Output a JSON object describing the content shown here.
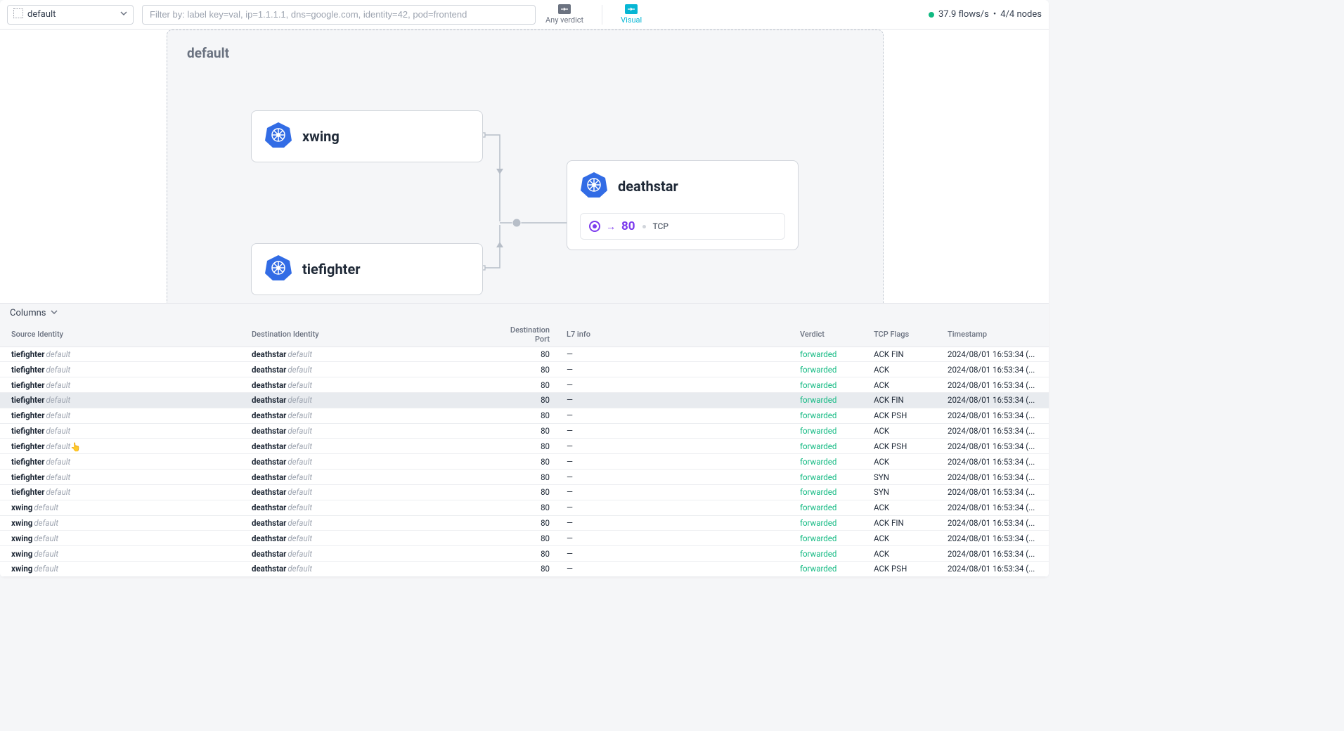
{
  "header": {
    "namespace": "default",
    "filter_placeholder": "Filter by: label key=val, ip=1.1.1.1, dns=google.com, identity=42, pod=frontend",
    "tabs": {
      "any_verdict": "Any verdict",
      "visual": "Visual"
    },
    "status": {
      "flows_rate": "37.9 flows/s",
      "separator": "•",
      "nodes": "4/4 nodes"
    }
  },
  "canvas": {
    "namespace_label": "default",
    "nodes": {
      "xwing": "xwing",
      "tiefighter": "tiefighter",
      "deathstar": {
        "name": "deathstar",
        "port": "80",
        "protocol": "TCP"
      }
    }
  },
  "table": {
    "columns_toggle": "Columns",
    "headers": {
      "source": "Source Identity",
      "destination": "Destination Identity",
      "dest_port": "Destination Port",
      "l7": "L7 info",
      "verdict": "Verdict",
      "tcp_flags": "TCP Flags",
      "timestamp": "Timestamp"
    },
    "rows": [
      {
        "src": "tiefighter",
        "src_ns": "default",
        "dst": "deathstar",
        "dst_ns": "default",
        "port": "80",
        "l7": "—",
        "verdict": "forwarded",
        "flags": "ACK FIN",
        "ts": "2024/08/01 16:53:34 (...",
        "hl": false
      },
      {
        "src": "tiefighter",
        "src_ns": "default",
        "dst": "deathstar",
        "dst_ns": "default",
        "port": "80",
        "l7": "—",
        "verdict": "forwarded",
        "flags": "ACK",
        "ts": "2024/08/01 16:53:34 (...",
        "hl": false
      },
      {
        "src": "tiefighter",
        "src_ns": "default",
        "dst": "deathstar",
        "dst_ns": "default",
        "port": "80",
        "l7": "—",
        "verdict": "forwarded",
        "flags": "ACK",
        "ts": "2024/08/01 16:53:34 (...",
        "hl": false
      },
      {
        "src": "tiefighter",
        "src_ns": "default",
        "dst": "deathstar",
        "dst_ns": "default",
        "port": "80",
        "l7": "—",
        "verdict": "forwarded",
        "flags": "ACK FIN",
        "ts": "2024/08/01 16:53:34 (...",
        "hl": true
      },
      {
        "src": "tiefighter",
        "src_ns": "default",
        "dst": "deathstar",
        "dst_ns": "default",
        "port": "80",
        "l7": "—",
        "verdict": "forwarded",
        "flags": "ACK PSH",
        "ts": "2024/08/01 16:53:34 (...",
        "hl": false
      },
      {
        "src": "tiefighter",
        "src_ns": "default",
        "dst": "deathstar",
        "dst_ns": "default",
        "port": "80",
        "l7": "—",
        "verdict": "forwarded",
        "flags": "ACK",
        "ts": "2024/08/01 16:53:34 (...",
        "hl": false
      },
      {
        "src": "tiefighter",
        "src_ns": "default",
        "dst": "deathstar",
        "dst_ns": "default",
        "port": "80",
        "l7": "—",
        "verdict": "forwarded",
        "flags": "ACK PSH",
        "ts": "2024/08/01 16:53:34 (...",
        "hl": false
      },
      {
        "src": "tiefighter",
        "src_ns": "default",
        "dst": "deathstar",
        "dst_ns": "default",
        "port": "80",
        "l7": "—",
        "verdict": "forwarded",
        "flags": "ACK",
        "ts": "2024/08/01 16:53:34 (...",
        "hl": false
      },
      {
        "src": "tiefighter",
        "src_ns": "default",
        "dst": "deathstar",
        "dst_ns": "default",
        "port": "80",
        "l7": "—",
        "verdict": "forwarded",
        "flags": "SYN",
        "ts": "2024/08/01 16:53:34 (...",
        "hl": false
      },
      {
        "src": "tiefighter",
        "src_ns": "default",
        "dst": "deathstar",
        "dst_ns": "default",
        "port": "80",
        "l7": "—",
        "verdict": "forwarded",
        "flags": "SYN",
        "ts": "2024/08/01 16:53:34 (...",
        "hl": false
      },
      {
        "src": "xwing",
        "src_ns": "default",
        "dst": "deathstar",
        "dst_ns": "default",
        "port": "80",
        "l7": "—",
        "verdict": "forwarded",
        "flags": "ACK",
        "ts": "2024/08/01 16:53:34 (...",
        "hl": false
      },
      {
        "src": "xwing",
        "src_ns": "default",
        "dst": "deathstar",
        "dst_ns": "default",
        "port": "80",
        "l7": "—",
        "verdict": "forwarded",
        "flags": "ACK FIN",
        "ts": "2024/08/01 16:53:34 (...",
        "hl": false
      },
      {
        "src": "xwing",
        "src_ns": "default",
        "dst": "deathstar",
        "dst_ns": "default",
        "port": "80",
        "l7": "—",
        "verdict": "forwarded",
        "flags": "ACK",
        "ts": "2024/08/01 16:53:34 (...",
        "hl": false
      },
      {
        "src": "xwing",
        "src_ns": "default",
        "dst": "deathstar",
        "dst_ns": "default",
        "port": "80",
        "l7": "—",
        "verdict": "forwarded",
        "flags": "ACK",
        "ts": "2024/08/01 16:53:34 (...",
        "hl": false
      },
      {
        "src": "xwing",
        "src_ns": "default",
        "dst": "deathstar",
        "dst_ns": "default",
        "port": "80",
        "l7": "—",
        "verdict": "forwarded",
        "flags": "ACK PSH",
        "ts": "2024/08/01 16:53:34 (...",
        "hl": false
      }
    ]
  }
}
